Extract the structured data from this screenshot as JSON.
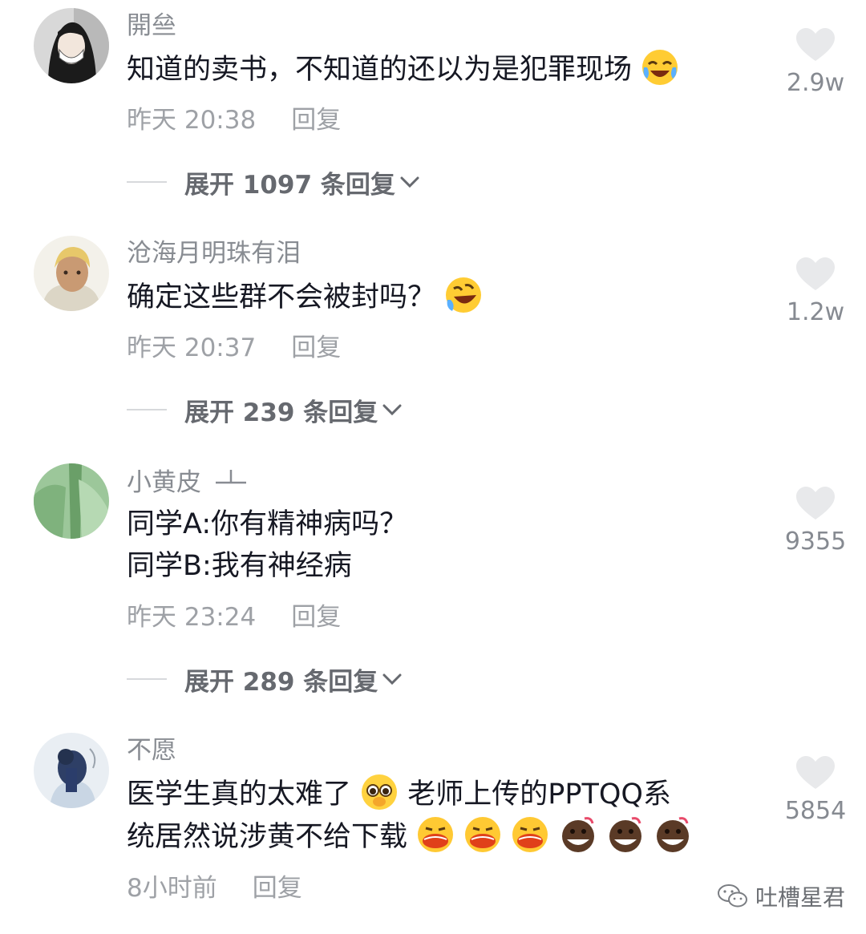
{
  "comments": [
    {
      "username": "開亝",
      "line1": "知道的卖书，不知道的还以为是犯罪现场",
      "time": "昨天 20:38",
      "reply_label": "回复",
      "expand_label": "展开 1097 条回复",
      "likes": "2.9w"
    },
    {
      "username": "沧海月明珠有泪",
      "line1": "确定这些群不会被封吗？",
      "time": "昨天 20:37",
      "reply_label": "回复",
      "expand_label": "展开 239 条回复",
      "likes": "1.2w"
    },
    {
      "username": "小黄皮",
      "line1": "同学A:你有精神病吗？",
      "line2": "同学B:我有神经病",
      "time": "昨天 23:24",
      "reply_label": "回复",
      "expand_label": "展开 289 条回复",
      "likes": "9355"
    },
    {
      "username": "不愿",
      "line1a": "医学生真的太难了",
      "line1b": "老师上传的PPTQQ系",
      "line2": "统居然说涉黄不给下载",
      "time": "8小时前",
      "reply_label": "回复",
      "likes": "5854"
    }
  ],
  "watermark": {
    "text": "吐槽星君"
  },
  "icons": {
    "like": "heart-icon",
    "expand": "chevron-down-icon",
    "emoji_1": "crying-laughing-emoji",
    "emoji_2": "rolling-laughing-emoji",
    "emoji_3": "pleading-emoji",
    "emoji_4": "shouting-emoji",
    "emoji_5": "dark-grinning-emoji",
    "badge": "level-badge-icon",
    "watermark_icon": "wechat-icon"
  },
  "colors": {
    "primary_text": "#161823",
    "secondary_text": "#888c92",
    "heart": "#e8e9eb"
  }
}
